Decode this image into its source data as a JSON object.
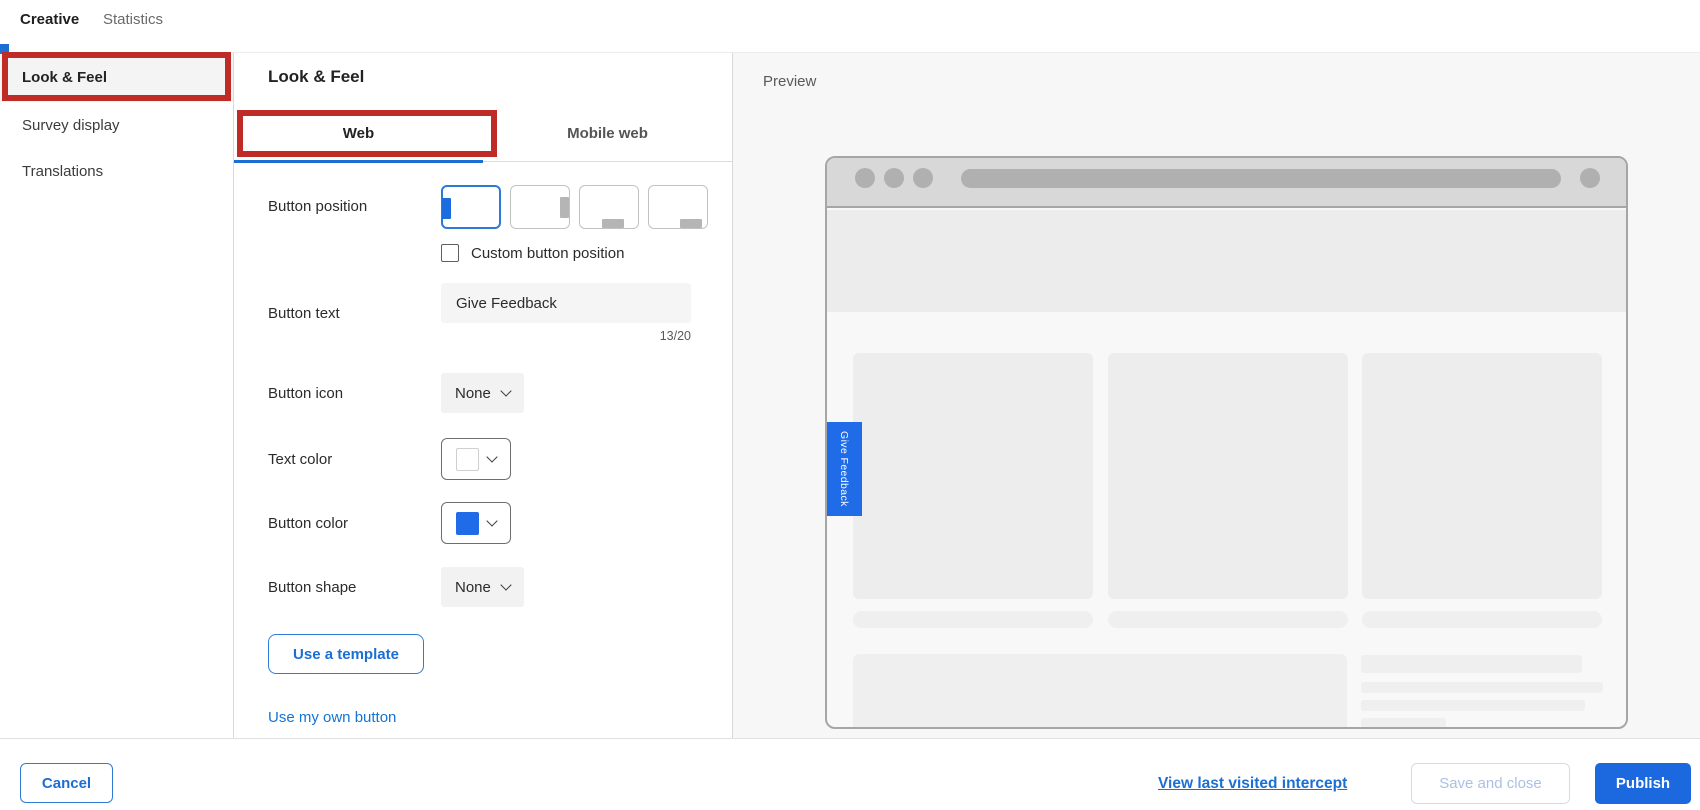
{
  "header": {
    "tabs": [
      {
        "label": "Creative",
        "active": true
      },
      {
        "label": "Statistics",
        "active": false
      }
    ]
  },
  "sidebar": {
    "items": [
      {
        "label": "Look & Feel",
        "selected": true,
        "annotated": true
      },
      {
        "label": "Survey display",
        "selected": false
      },
      {
        "label": "Translations",
        "selected": false
      }
    ]
  },
  "editor": {
    "title": "Look & Feel",
    "tabs": [
      {
        "label": "Web",
        "active": true,
        "annotated": true
      },
      {
        "label": "Mobile web",
        "active": false
      }
    ],
    "button_position": {
      "label": "Button position",
      "options": [
        "left-middle",
        "right-middle",
        "bottom-center",
        "bottom-right"
      ],
      "selected": "left-middle",
      "custom_checkbox_label": "Custom button position",
      "custom_checkbox_checked": false
    },
    "button_text": {
      "label": "Button text",
      "value": "Give Feedback",
      "counter": "13/20"
    },
    "button_icon": {
      "label": "Button icon",
      "value": "None"
    },
    "text_color": {
      "label": "Text color",
      "value": "#ffffff"
    },
    "button_color": {
      "label": "Button color",
      "value": "#1f6be8"
    },
    "button_shape": {
      "label": "Button shape",
      "value": "None"
    },
    "template_button_label": "Use a template",
    "own_button_link_label": "Use my own button"
  },
  "preview": {
    "title": "Preview",
    "feedback_button_label": "Give Feedback"
  },
  "footer": {
    "cancel_label": "Cancel",
    "view_link_label": "View last visited intercept",
    "save_label": "Save and close",
    "save_enabled": false,
    "publish_label": "Publish"
  },
  "colors": {
    "accent_blue": "#1b6fd4",
    "fill_blue": "#1f6be8",
    "annotation_red": "#bf2b26",
    "disabled_text": "#aac1e4"
  }
}
